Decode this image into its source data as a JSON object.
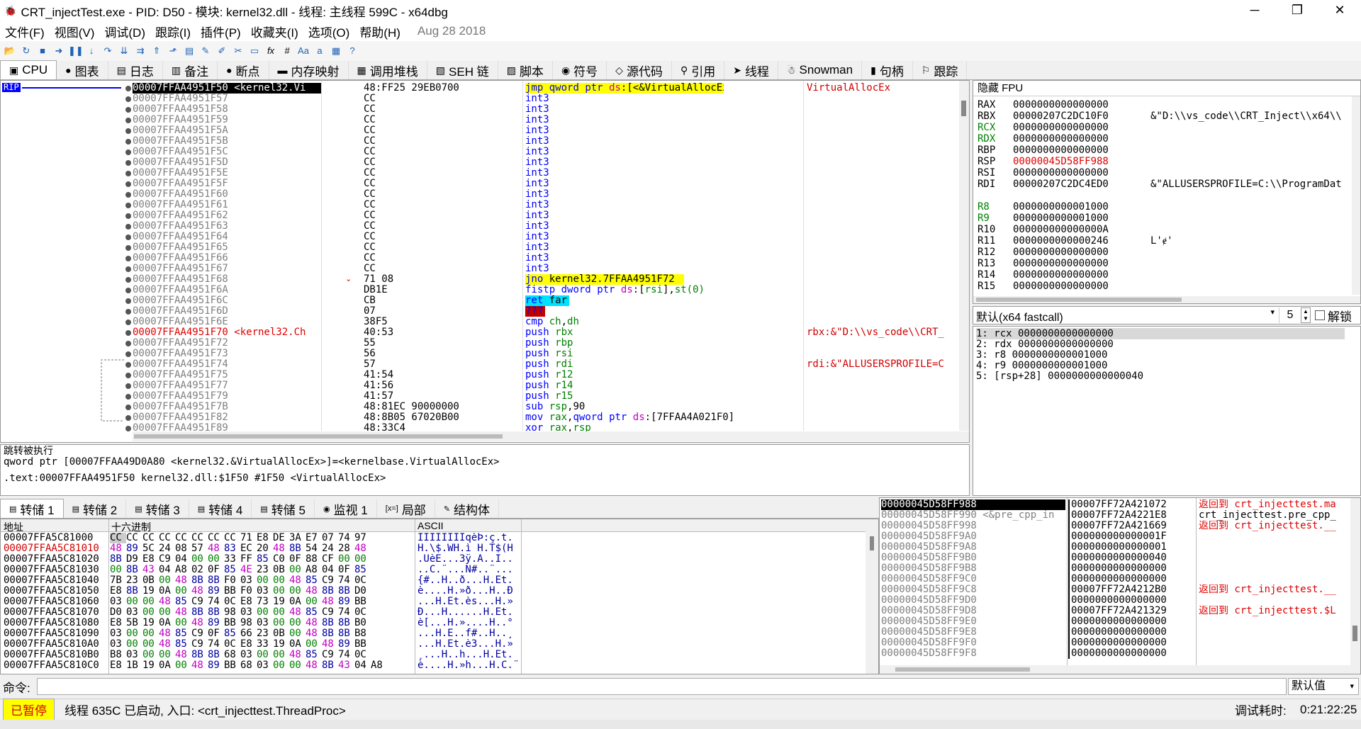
{
  "window": {
    "title": "CRT_injectTest.exe - PID: D50 - 模块: kernel32.dll - 线程: 主线程 599C - x64dbg",
    "minimize": "─",
    "maximize": "❐",
    "close": "✕"
  },
  "menu": {
    "items": [
      "文件(F)",
      "视图(V)",
      "调试(D)",
      "跟踪(I)",
      "插件(P)",
      "收藏夹(I)",
      "选项(O)",
      "帮助(H)"
    ],
    "date": "Aug 28 2018"
  },
  "toolbar": {
    "icons": [
      "open-icon",
      "restart-icon",
      "stop-icon",
      "run-icon",
      "pause-icon",
      "step-into-icon",
      "step-over-icon",
      "trace-into-icon",
      "trace-over-icon",
      "execute-till-return-icon",
      "run-to-user-code-icon",
      "script-icon",
      "comment-icon",
      "label-icon",
      "bookmark-icon",
      "function-icon",
      "fx-icon",
      "hash-icon",
      "font-icon",
      "case-icon",
      "calculator-icon",
      "help-icon"
    ],
    "fx": "fx",
    "hash": "#"
  },
  "tabs": [
    {
      "label": "CPU",
      "icon": "cpu-icon",
      "glyph": "▣",
      "active": true
    },
    {
      "label": "图表",
      "icon": "graph-icon",
      "glyph": "●"
    },
    {
      "label": "日志",
      "icon": "log-icon",
      "glyph": "▤"
    },
    {
      "label": "备注",
      "icon": "notes-icon",
      "glyph": "▥"
    },
    {
      "label": "断点",
      "icon": "breakpoint-icon",
      "glyph": "●"
    },
    {
      "label": "内存映射",
      "icon": "memory-map-icon",
      "glyph": "▬"
    },
    {
      "label": "调用堆栈",
      "icon": "call-stack-icon",
      "glyph": "▦"
    },
    {
      "label": "SEH 链",
      "icon": "seh-icon",
      "glyph": "▧"
    },
    {
      "label": "脚本",
      "icon": "script-icon",
      "glyph": "▨"
    },
    {
      "label": "符号",
      "icon": "symbols-icon",
      "glyph": "◉"
    },
    {
      "label": "源代码",
      "icon": "source-icon",
      "glyph": "◇"
    },
    {
      "label": "引用",
      "icon": "references-icon",
      "glyph": "⚲"
    },
    {
      "label": "线程",
      "icon": "threads-icon",
      "glyph": "➤"
    },
    {
      "label": "Snowman",
      "icon": "snowman-icon",
      "glyph": "☃"
    },
    {
      "label": "句柄",
      "icon": "handles-icon",
      "glyph": "▮"
    },
    {
      "label": "跟踪",
      "icon": "trace-icon",
      "glyph": "⚐"
    }
  ],
  "cpu": {
    "rip_label": "RIP",
    "rows": [
      {
        "addr": "00007FFAA4951F50 <kernel32.Vi",
        "bytes": "48:FF25 29EB0700",
        "dism": "jmp qword ptr ds:[<&VirtualAllocEx>]",
        "cmt": "VirtualAllocEx",
        "style": "sel"
      },
      {
        "addr": "00007FFAA4951F57",
        "bytes": "CC",
        "dism": "int3",
        "cmt": ""
      },
      {
        "addr": "00007FFAA4951F58",
        "bytes": "CC",
        "dism": "int3",
        "cmt": ""
      },
      {
        "addr": "00007FFAA4951F59",
        "bytes": "CC",
        "dism": "int3",
        "cmt": ""
      },
      {
        "addr": "00007FFAA4951F5A",
        "bytes": "CC",
        "dism": "int3",
        "cmt": ""
      },
      {
        "addr": "00007FFAA4951F5B",
        "bytes": "CC",
        "dism": "int3",
        "cmt": ""
      },
      {
        "addr": "00007FFAA4951F5C",
        "bytes": "CC",
        "dism": "int3",
        "cmt": ""
      },
      {
        "addr": "00007FFAA4951F5D",
        "bytes": "CC",
        "dism": "int3",
        "cmt": ""
      },
      {
        "addr": "00007FFAA4951F5E",
        "bytes": "CC",
        "dism": "int3",
        "cmt": ""
      },
      {
        "addr": "00007FFAA4951F5F",
        "bytes": "CC",
        "dism": "int3",
        "cmt": ""
      },
      {
        "addr": "00007FFAA4951F60",
        "bytes": "CC",
        "dism": "int3",
        "cmt": ""
      },
      {
        "addr": "00007FFAA4951F61",
        "bytes": "CC",
        "dism": "int3",
        "cmt": ""
      },
      {
        "addr": "00007FFAA4951F62",
        "bytes": "CC",
        "dism": "int3",
        "cmt": ""
      },
      {
        "addr": "00007FFAA4951F63",
        "bytes": "CC",
        "dism": "int3",
        "cmt": ""
      },
      {
        "addr": "00007FFAA4951F64",
        "bytes": "CC",
        "dism": "int3",
        "cmt": ""
      },
      {
        "addr": "00007FFAA4951F65",
        "bytes": "CC",
        "dism": "int3",
        "cmt": ""
      },
      {
        "addr": "00007FFAA4951F66",
        "bytes": "CC",
        "dism": "int3",
        "cmt": ""
      },
      {
        "addr": "00007FFAA4951F67",
        "bytes": "CC",
        "dism": "int3",
        "cmt": ""
      },
      {
        "addr": "00007FFAA4951F68",
        "bytes": "71 08",
        "dism": "jno kernel32.7FFAA4951F72",
        "cmt": "",
        "marker": "⌄"
      },
      {
        "addr": "00007FFAA4951F6A",
        "bytes": "DB1E",
        "dism": "fistp dword ptr ds:[rsi],st(0)",
        "cmt": ""
      },
      {
        "addr": "00007FFAA4951F6C",
        "bytes": "CB",
        "dism": "ret far",
        "cmt": ""
      },
      {
        "addr": "00007FFAA4951F6D",
        "bytes": "07",
        "dism": "???",
        "cmt": ""
      },
      {
        "addr": "00007FFAA4951F6E",
        "bytes": "38F5",
        "dism": "cmp ch,dh",
        "cmt": ""
      },
      {
        "addr": "00007FFAA4951F70 <kernel32.Ch",
        "bytes": "40:53",
        "dism": "push rbx",
        "cmt": "rbx:&\"D:\\\\vs_code\\\\CRT_",
        "style": "red"
      },
      {
        "addr": "00007FFAA4951F72",
        "bytes": "55",
        "dism": "push rbp",
        "cmt": ""
      },
      {
        "addr": "00007FFAA4951F73",
        "bytes": "56",
        "dism": "push rsi",
        "cmt": ""
      },
      {
        "addr": "00007FFAA4951F74",
        "bytes": "57",
        "dism": "push rdi",
        "cmt": "rdi:&\"ALLUSERSPROFILE=C"
      },
      {
        "addr": "00007FFAA4951F75",
        "bytes": "41:54",
        "dism": "push r12",
        "cmt": ""
      },
      {
        "addr": "00007FFAA4951F77",
        "bytes": "41:56",
        "dism": "push r14",
        "cmt": ""
      },
      {
        "addr": "00007FFAA4951F79",
        "bytes": "41:57",
        "dism": "push r15",
        "cmt": ""
      },
      {
        "addr": "00007FFAA4951F7B",
        "bytes": "48:81EC 90000000",
        "dism": "sub rsp,90",
        "cmt": ""
      },
      {
        "addr": "00007FFAA4951F82",
        "bytes": "48:8B05 67020B00",
        "dism": "mov rax,qword ptr ds:[7FFAA4A021F0]",
        "cmt": ""
      },
      {
        "addr": "00007FFAA4951F89",
        "bytes": "48:33C4",
        "dism": "xor rax,rsp",
        "cmt": ""
      }
    ]
  },
  "registers": {
    "header": "隐藏 FPU",
    "rows": [
      {
        "name": "RAX",
        "value": "0000000000000000",
        "info": ""
      },
      {
        "name": "RBX",
        "value": "00000207C2DC10F0",
        "info": "&\"D:\\\\vs_code\\\\CRT_Inject\\\\x64\\\\"
      },
      {
        "name": "RCX",
        "value": "0000000000000000",
        "info": "",
        "color": "#008000"
      },
      {
        "name": "RDX",
        "value": "0000000000000000",
        "info": "",
        "color": "#008000"
      },
      {
        "name": "RBP",
        "value": "0000000000000000",
        "info": ""
      },
      {
        "name": "RSP",
        "value": "00000045D58FF988",
        "info": "",
        "vcolor": "#e00000"
      },
      {
        "name": "RSI",
        "value": "0000000000000000",
        "info": ""
      },
      {
        "name": "RDI",
        "value": "00000207C2DC4ED0",
        "info": "&\"ALLUSERSPROFILE=C:\\\\ProgramDat"
      },
      {
        "name": "",
        "value": "",
        "info": ""
      },
      {
        "name": "R8",
        "value": "0000000000001000",
        "info": "",
        "color": "#008000"
      },
      {
        "name": "R9",
        "value": "0000000000001000",
        "info": "",
        "color": "#008000"
      },
      {
        "name": "R10",
        "value": "000000000000000A",
        "info": ""
      },
      {
        "name": "R11",
        "value": "0000000000000246",
        "info": "L'ɇ'"
      },
      {
        "name": "R12",
        "value": "0000000000000000",
        "info": ""
      },
      {
        "name": "R13",
        "value": "0000000000000000",
        "info": ""
      },
      {
        "name": "R14",
        "value": "0000000000000000",
        "info": ""
      },
      {
        "name": "R15",
        "value": "0000000000000000",
        "info": ""
      }
    ]
  },
  "callconv": {
    "selected": "默认(x64 fastcall)",
    "count": "5",
    "unlock_label": "解锁",
    "arrow": "▾",
    "spin_up": "▲",
    "spin_down": "▼"
  },
  "args": [
    "1: rcx 0000000000000000",
    "2: rdx 0000000000000000",
    "3: r8 0000000000001000",
    "4: r9 0000000000001000",
    "5: [rsp+28] 0000000000000040"
  ],
  "info": {
    "line1": "跳转被执行",
    "line2": "qword ptr [00007FFAA49D0A80 <kernel32.&VirtualAllocEx>]=<kernelbase.VirtualAllocEx>",
    "line3": ".text:00007FFAA4951F50 kernel32.dll:$1F50 #1F50 <VirtualAllocEx>"
  },
  "dump_tabs": [
    {
      "label": "转储 1",
      "icon": "dump-icon",
      "active": true
    },
    {
      "label": "转储 2",
      "icon": "dump-icon"
    },
    {
      "label": "转储 3",
      "icon": "dump-icon"
    },
    {
      "label": "转储 4",
      "icon": "dump-icon"
    },
    {
      "label": "转储 5",
      "icon": "dump-icon"
    },
    {
      "label": "监视 1",
      "icon": "watch-icon"
    },
    {
      "label": "局部",
      "icon": "locals-icon"
    },
    {
      "label": "结构体",
      "icon": "struct-icon"
    }
  ],
  "dump": {
    "headers": {
      "addr": "地址",
      "hex": "十六进制",
      "ascii": "ASCII"
    },
    "rows": [
      {
        "addr": "00007FFA5C81000",
        "hex": [
          "CC",
          "CC",
          "CC",
          "CC",
          "CC",
          "CC",
          "CC",
          "CC",
          "71",
          "E8",
          "DE",
          "3A",
          "E7",
          "07",
          "74",
          "97"
        ],
        "ascii": "ÌÌÌÌÌÌÌÌqèÞ:ç.t."
      },
      {
        "addr": "00007FFAA5C81010",
        "hex": [
          "48",
          "89",
          "5C",
          "24",
          "08",
          "57",
          "48",
          "83",
          "EC",
          "20",
          "48",
          "8B",
          "54",
          "24",
          "28",
          "48"
        ],
        "ascii": "H.\\$.WH.ì H.T$(H",
        "red": true
      },
      {
        "addr": "00007FFAA5C81020",
        "hex": [
          "8B",
          "D9",
          "E8",
          "C9",
          "04",
          "00",
          "00",
          "33",
          "FF",
          "85",
          "C0",
          "0F",
          "88",
          "CF",
          "00",
          "00"
        ],
        "ascii": ".ÙèÉ...3ÿ.À..Ï.."
      },
      {
        "addr": "00007FFAA5C81030",
        "hex": [
          "00",
          "8B",
          "43",
          "04",
          "A8",
          "02",
          "0F",
          "85",
          "4E",
          "23",
          "0B",
          "00",
          "A8",
          "04",
          "0F",
          "85"
        ],
        "ascii": "..C.¨...N#..¨..."
      },
      {
        "addr": "00007FFAA5C81040",
        "hex": [
          "7B",
          "23",
          "0B",
          "00",
          "48",
          "8B",
          "8B",
          "F0",
          "03",
          "00",
          "00",
          "48",
          "85",
          "C9",
          "74",
          "0C"
        ],
        "ascii": "{#..H..ð...H.Ét."
      },
      {
        "addr": "00007FFAA5C81050",
        "hex": [
          "E8",
          "8B",
          "19",
          "0A",
          "00",
          "48",
          "89",
          "BB",
          "F0",
          "03",
          "00",
          "00",
          "48",
          "8B",
          "8B",
          "D0"
        ],
        "ascii": "è....H.»ð...H..Ð"
      },
      {
        "addr": "00007FFAA5C81060",
        "hex": [
          "03",
          "00",
          "00",
          "48",
          "85",
          "C9",
          "74",
          "0C",
          "E8",
          "73",
          "19",
          "0A",
          "00",
          "48",
          "89",
          "BB"
        ],
        "ascii": "...H.Ét.ès...H.»"
      },
      {
        "addr": "00007FFAA5C81070",
        "hex": [
          "D0",
          "03",
          "00",
          "00",
          "48",
          "8B",
          "8B",
          "98",
          "03",
          "00",
          "00",
          "48",
          "85",
          "C9",
          "74",
          "0C"
        ],
        "ascii": "Ð...H......H.Ét."
      },
      {
        "addr": "00007FFAA5C81080",
        "hex": [
          "E8",
          "5B",
          "19",
          "0A",
          "00",
          "48",
          "89",
          "BB",
          "98",
          "03",
          "00",
          "00",
          "48",
          "8B",
          "8B",
          "B0"
        ],
        "ascii": "è[...H.»....H..°"
      },
      {
        "addr": "00007FFAA5C81090",
        "hex": [
          "03",
          "00",
          "00",
          "48",
          "85",
          "C9",
          "0F",
          "85",
          "66",
          "23",
          "0B",
          "00",
          "48",
          "8B",
          "8B",
          "B8"
        ],
        "ascii": "...H.É..f#..H..¸"
      },
      {
        "addr": "00007FFAA5C810A0",
        "hex": [
          "03",
          "00",
          "00",
          "48",
          "85",
          "C9",
          "74",
          "0C",
          "E8",
          "33",
          "19",
          "0A",
          "00",
          "48",
          "89",
          "BB"
        ],
        "ascii": "...H.Ét.è3...H.»"
      },
      {
        "addr": "00007FFAA5C810B0",
        "hex": [
          "B8",
          "03",
          "00",
          "00",
          "48",
          "8B",
          "8B",
          "68",
          "03",
          "00",
          "00",
          "48",
          "85",
          "C9",
          "74",
          "0C"
        ],
        "ascii": "¸...H..h...H.Ét."
      },
      {
        "addr": "00007FFAA5C810C0",
        "hex": [
          "E8",
          "1B",
          "19",
          "0A",
          "00",
          "48",
          "89",
          "BB",
          "68",
          "03",
          "00",
          "00",
          "48",
          "8B",
          "43",
          "04",
          "A8"
        ],
        "ascii": "è....H.»h...H.C.¨"
      }
    ]
  },
  "stack": {
    "rows": [
      {
        "addr": "00000045D58FF988",
        "val": "00007FF72A421072",
        "cmt": "返回到 crt_injecttest.ma",
        "sel": true,
        "red": true
      },
      {
        "addr": "00000045D58FF990 <&pre_cpp_in",
        "val": "00007FF72A4221E8",
        "cmt": "crt_injecttest.pre_cpp_"
      },
      {
        "addr": "00000045D58FF998",
        "val": "00007FF72A421669",
        "cmt": "返回到 crt_injecttest.__",
        "red": true
      },
      {
        "addr": "00000045D58FF9A0",
        "val": "000000000000001F",
        "cmt": ""
      },
      {
        "addr": "00000045D58FF9A8",
        "val": "0000000000000001",
        "cmt": ""
      },
      {
        "addr": "00000045D58FF9B0",
        "val": "0000000000000040",
        "cmt": ""
      },
      {
        "addr": "00000045D58FF9B8",
        "val": "0000000000000000",
        "cmt": ""
      },
      {
        "addr": "00000045D58FF9C0",
        "val": "0000000000000000",
        "cmt": ""
      },
      {
        "addr": "00000045D58FF9C8",
        "val": "00007FF72A4212B0",
        "cmt": "返回到 crt_injecttest.__",
        "red": true
      },
      {
        "addr": "00000045D58FF9D0",
        "val": "0000000000000000",
        "cmt": ""
      },
      {
        "addr": "00000045D58FF9D8",
        "val": "00007FF72A421329",
        "cmt": "返回到 crt_injecttest.$L",
        "red": true
      },
      {
        "addr": "00000045D58FF9E0",
        "val": "0000000000000000",
        "cmt": ""
      },
      {
        "addr": "00000045D58FF9E8",
        "val": "0000000000000000",
        "cmt": ""
      },
      {
        "addr": "00000045D58FF9F0",
        "val": "0000000000000000",
        "cmt": ""
      },
      {
        "addr": "00000045D58FF9F8",
        "val": "0000000000000000",
        "cmt": ""
      }
    ]
  },
  "cmd": {
    "label": "命令:",
    "default": "默认值",
    "arrow": "▾"
  },
  "status": {
    "paused": "已暂停",
    "message": "线程 635C 已启动, 入口: <crt_injecttest.ThreadProc>",
    "time_label": "调试耗时:",
    "time_value": "0:21:22:25"
  },
  "colors": {
    "accent": "#0000ff",
    "paused_bg": "#ffff00",
    "paused_fg": "#d00000",
    "return_red": "#e00000"
  }
}
